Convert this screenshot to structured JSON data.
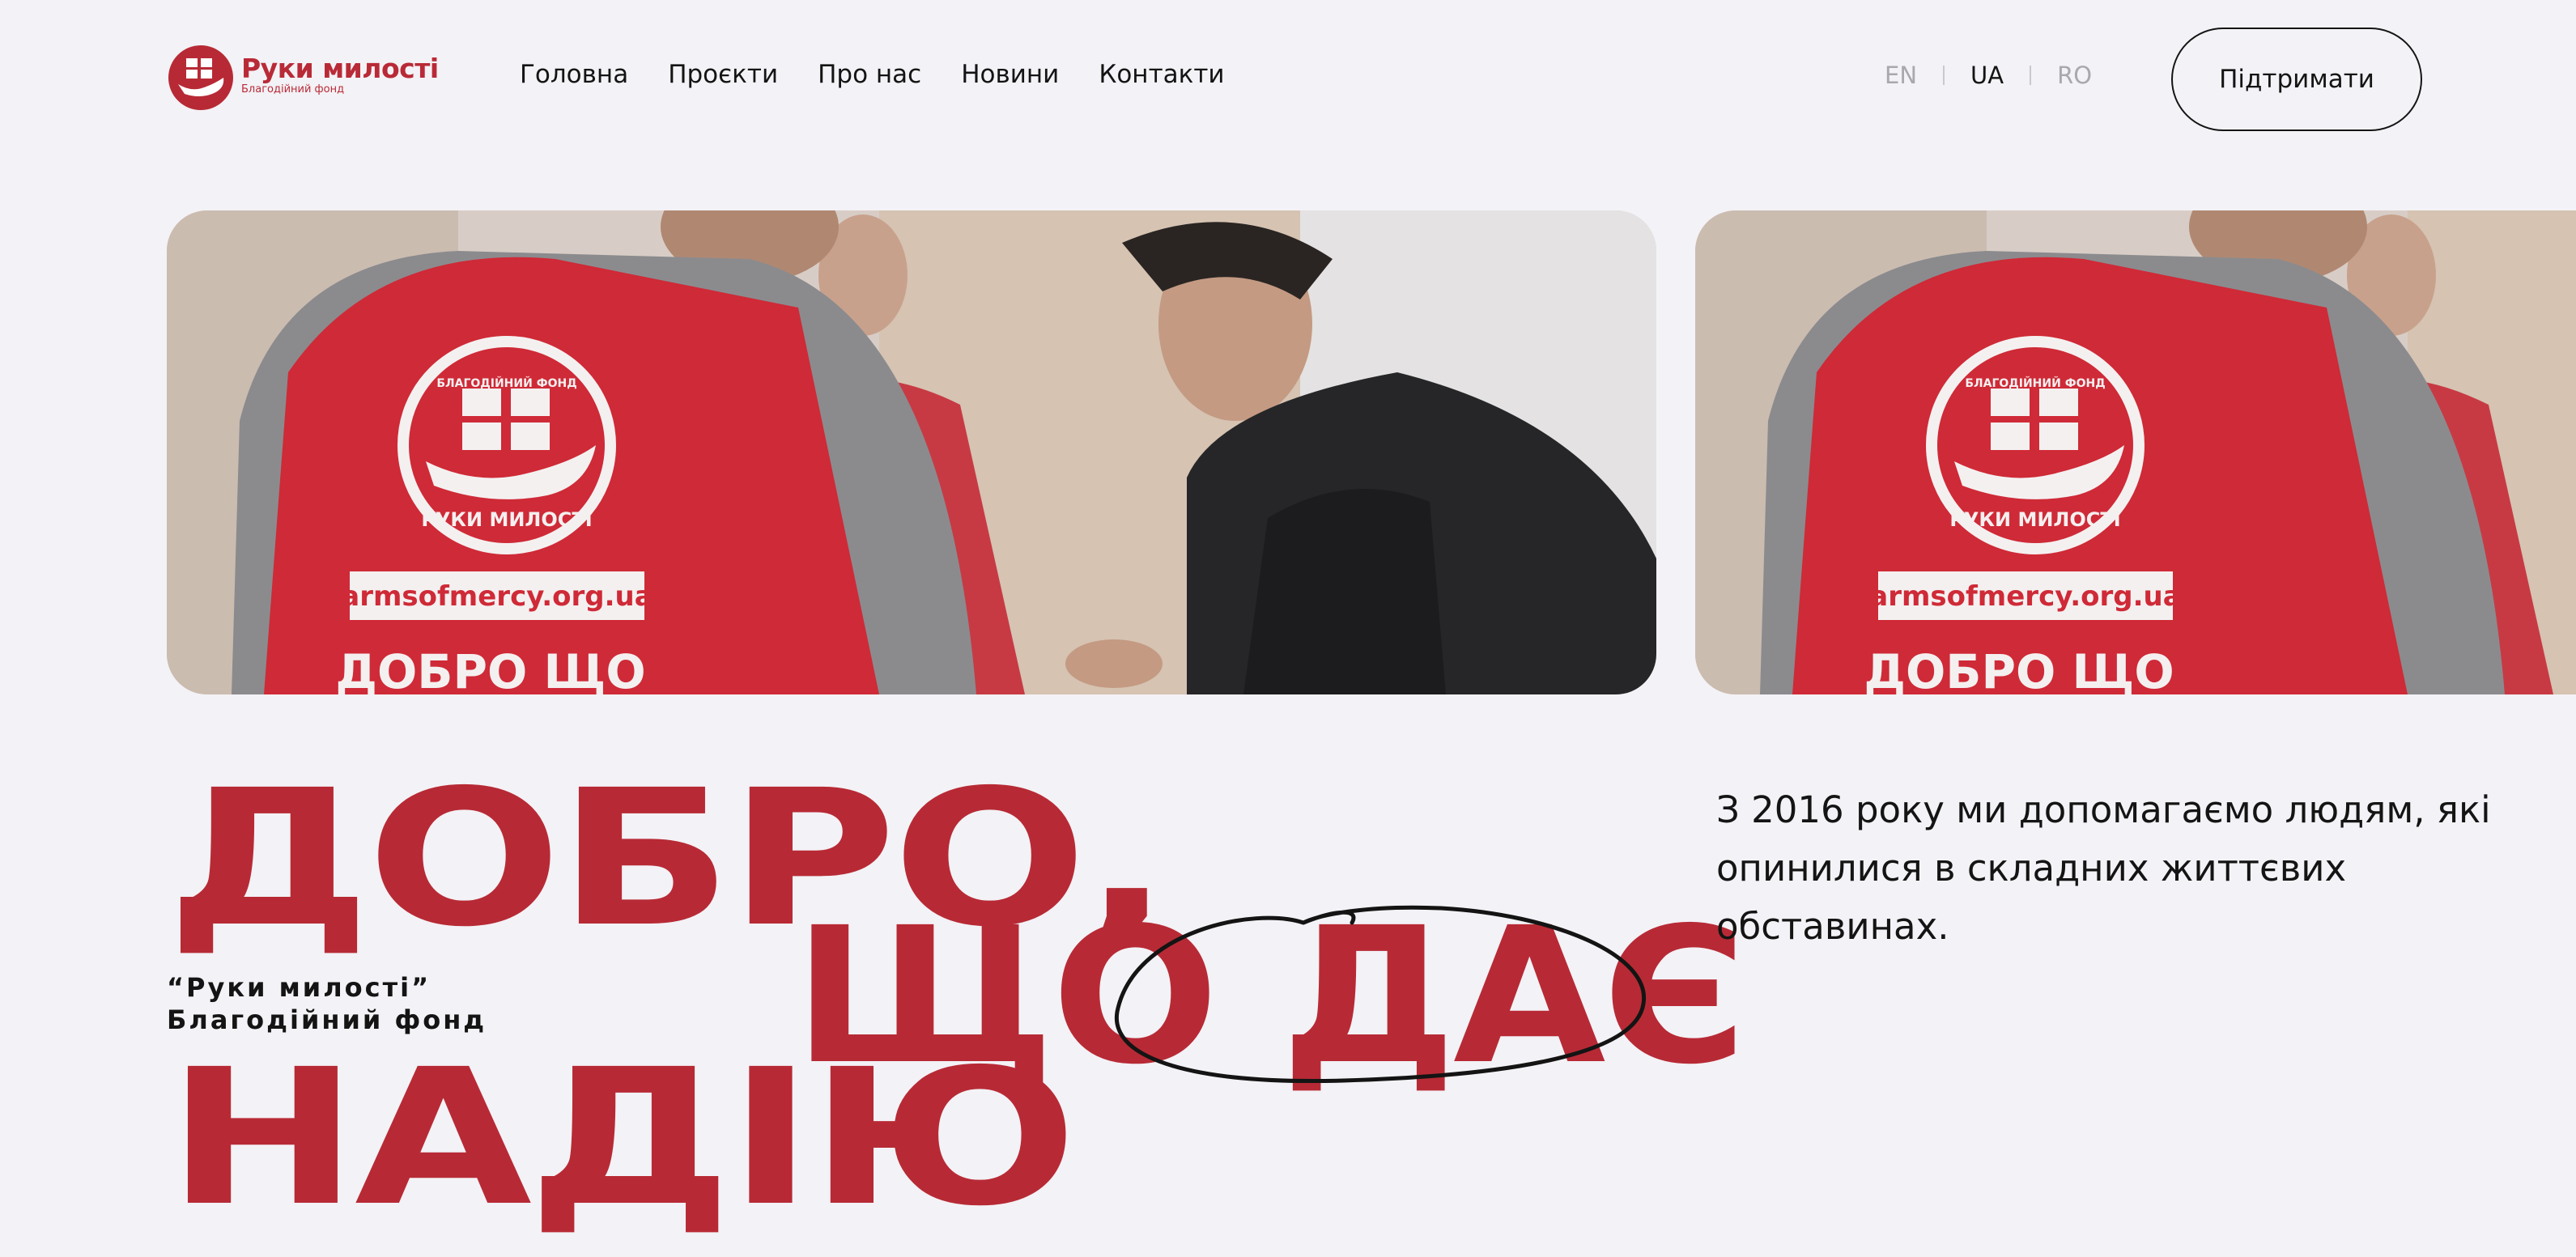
{
  "header": {
    "logo": {
      "name": "Руки милості",
      "subtitle": "Благодійний фонд"
    },
    "nav": [
      {
        "label": "Головна"
      },
      {
        "label": "Проєкти"
      },
      {
        "label": "Про нас"
      },
      {
        "label": "Новини"
      },
      {
        "label": "Контакти"
      }
    ],
    "languages": [
      {
        "code": "EN",
        "active": false
      },
      {
        "code": "UA",
        "active": true
      },
      {
        "code": "RO",
        "active": false
      }
    ],
    "support_button": "Підтримати"
  },
  "gallery": {
    "slides": [
      {
        "vest_site": "armsofmercy.org.ua",
        "vest_slogan": "ДОБРО ЩО",
        "vest_logo_text": "РУКИ МИЛОСТІ",
        "vest_logo_top": "БЛАГОДІЙНИЙ ФОНД"
      },
      {
        "vest_site": "armsofmercy.org.ua",
        "vest_slogan": "ДОБРО ЩО",
        "vest_logo_text": "РУКИ МИЛОСТІ",
        "vest_logo_top": "БЛАГОДІЙНИЙ ФОНД"
      }
    ]
  },
  "hero": {
    "line1": "ДОБРО,",
    "line2": "ЩО ДАЄ",
    "line3": "НАДІЮ",
    "caption_line1": "“Руки милості”",
    "caption_line2": "Благодійний фонд"
  },
  "intro": {
    "text": "З 2016 року ми допомагаємо людям, які опинилися в складних життєвих обставинах."
  },
  "colors": {
    "brand_red": "#b72a35",
    "background": "#f3f2f6",
    "text": "#141414",
    "muted": "#a8a8ad"
  }
}
